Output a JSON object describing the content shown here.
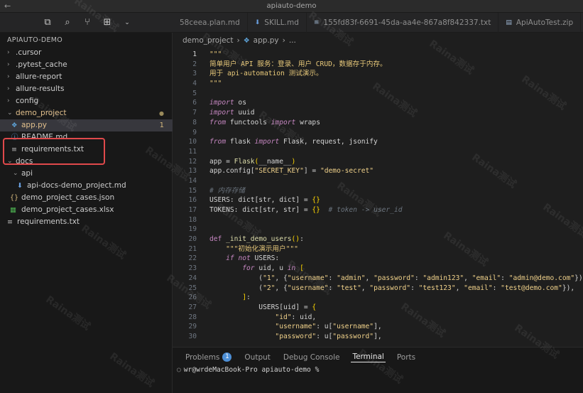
{
  "window": {
    "title": "apiauto-demo",
    "back_glyph": "←"
  },
  "toolbar": {
    "icons": [
      "copy-icon",
      "search-icon",
      "source-control-icon",
      "extensions-icon",
      "chevron-down-icon"
    ]
  },
  "tabs": [
    {
      "label": "58ceea.plan.md",
      "icon": ""
    },
    {
      "label": "SKILL.md",
      "icon": "download-icon"
    },
    {
      "label": "155fd83f-6691-45da-aa4e-867a8f842337.txt",
      "icon": "lines-icon"
    },
    {
      "label": "ApiAutoTest.zip",
      "icon": "file-icon"
    }
  ],
  "explorer": {
    "header": "APIAUTO-DEMO",
    "items": [
      {
        "label": ".cursor",
        "type": "folder",
        "depth": 0,
        "expanded": false
      },
      {
        "label": ".pytest_cache",
        "type": "folder",
        "depth": 0,
        "expanded": false
      },
      {
        "label": "allure-report",
        "type": "folder",
        "depth": 0,
        "expanded": false
      },
      {
        "label": "allure-results",
        "type": "folder",
        "depth": 0,
        "expanded": false
      },
      {
        "label": "config",
        "type": "folder",
        "depth": 0,
        "expanded": false
      },
      {
        "label": "demo_project",
        "type": "folder",
        "depth": 0,
        "expanded": true,
        "badge": "●"
      },
      {
        "label": "app.py",
        "type": "python",
        "depth": 1,
        "badge": "1",
        "selected": true
      },
      {
        "label": "README.md",
        "type": "info",
        "depth": 0
      },
      {
        "label": "requirements.txt",
        "type": "text",
        "depth": 0
      },
      {
        "label": "docs",
        "type": "folder",
        "depth": 0,
        "expanded": true
      },
      {
        "label": "api",
        "type": "folder",
        "depth": 1,
        "expanded": true
      },
      {
        "label": "api-docs-demo_project.md",
        "type": "download",
        "depth": 2
      },
      {
        "label": "demo_project_cases.json",
        "type": "json",
        "depth": 1
      },
      {
        "label": "demo_project_cases.xlsx",
        "type": "excel",
        "depth": 1
      },
      {
        "label": "requirements.txt",
        "type": "text",
        "depth": 0
      }
    ]
  },
  "breadcrumb": {
    "folder": "demo_project",
    "sep": "›",
    "file": "app.py",
    "tail": "..."
  },
  "code_lines": [
    {
      "n": "1",
      "html": "<span class=\"doc\">\"\"\"</span>"
    },
    {
      "n": "2",
      "html": "<span class=\"doc\">简单用户 API 服务：登录、用户 CRUD，数据存于内存。</span>"
    },
    {
      "n": "3",
      "html": "<span class=\"doc\">用于 api-automation 测试演示。</span>"
    },
    {
      "n": "4",
      "html": "<span class=\"doc\">\"\"\"</span>"
    },
    {
      "n": "5",
      "html": ""
    },
    {
      "n": "6",
      "html": "<span class=\"kw\">import</span> os"
    },
    {
      "n": "7",
      "html": "<span class=\"kw\">import</span> uuid"
    },
    {
      "n": "8",
      "html": "<span class=\"kw\">from</span> functools <span class=\"kw\">import</span> wraps"
    },
    {
      "n": "9",
      "html": ""
    },
    {
      "n": "10",
      "html": "<span class=\"kw\">from</span> flask <span class=\"kw\">import</span> Flask, request, jsonify"
    },
    {
      "n": "11",
      "html": ""
    },
    {
      "n": "12",
      "html": "app = <span class=\"fn\">Flask</span><span class=\"br\">(</span>__name__<span class=\"br\">)</span>"
    },
    {
      "n": "13",
      "html": "app.config[<span class=\"str\">\"SECRET_KEY\"</span>] = <span class=\"str\">\"demo-secret\"</span>"
    },
    {
      "n": "14",
      "html": ""
    },
    {
      "n": "15",
      "html": "<span class=\"cm\"># 内存存储</span>"
    },
    {
      "n": "16",
      "html": "USERS: dict[str, dict] = <span class=\"br\">{}</span>"
    },
    {
      "n": "17",
      "html": "TOKENS: dict[str, str] = <span class=\"br\">{}</span>  <span class=\"cm\"># token -> user_id</span>"
    },
    {
      "n": "18",
      "html": ""
    },
    {
      "n": "19",
      "html": ""
    },
    {
      "n": "20",
      "html": "<span class=\"def\">def</span> <span class=\"fn\">_init_demo_users</span><span class=\"br\">()</span>:"
    },
    {
      "n": "21",
      "html": "    <span class=\"doc\">\"\"\"初始化演示用户\"\"\"</span>"
    },
    {
      "n": "22",
      "html": "    <span class=\"kw\">if</span> <span class=\"kw\">not</span> USERS:"
    },
    {
      "n": "23",
      "html": "        <span class=\"kw\">for</span> uid, u <span class=\"kw\">in</span> <span class=\"br\">[</span>"
    },
    {
      "n": "24",
      "html": "            (<span class=\"str\">\"1\"</span>, {<span class=\"str\">\"username\"</span>: <span class=\"str\">\"admin\"</span>, <span class=\"str\">\"password\"</span>: <span class=\"str\">\"admin123\"</span>, <span class=\"str\">\"email\"</span>: <span class=\"str\">\"admin@demo.com\"</span>}),"
    },
    {
      "n": "25",
      "html": "            (<span class=\"str\">\"2\"</span>, {<span class=\"str\">\"username\"</span>: <span class=\"str\">\"test\"</span>, <span class=\"str\">\"password\"</span>: <span class=\"str\">\"test123\"</span>, <span class=\"str\">\"email\"</span>: <span class=\"str\">\"test@demo.com\"</span>}),"
    },
    {
      "n": "26",
      "html": "        <span class=\"br\">]</span>:"
    },
    {
      "n": "27",
      "html": "            USERS[uid] = <span class=\"br\">{</span>"
    },
    {
      "n": "28",
      "html": "                <span class=\"str\">\"id\"</span>: uid,"
    },
    {
      "n": "29",
      "html": "                <span class=\"str\">\"username\"</span>: u[<span class=\"str\">\"username\"</span>],"
    },
    {
      "n": "30",
      "html": "                <span class=\"str\">\"password\"</span>: u[<span class=\"str\">\"password\"</span>],"
    }
  ],
  "panel": {
    "tabs": [
      {
        "label": "Problems",
        "badge": "1"
      },
      {
        "label": "Output"
      },
      {
        "label": "Debug Console"
      },
      {
        "label": "Terminal",
        "active": true
      },
      {
        "label": "Ports"
      }
    ],
    "terminal_prompt": "wr@wrdeMacBook-Pro apiauto-demo %"
  },
  "watermark_text": "Raina测试"
}
